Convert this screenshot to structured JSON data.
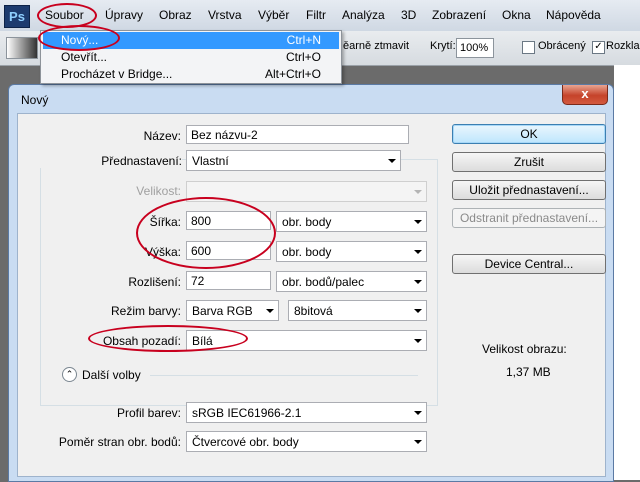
{
  "menubar": {
    "logo": "Ps",
    "items": [
      "Soubor",
      "Úpravy",
      "Obraz",
      "Vrstva",
      "Výběr",
      "Filtr",
      "Analýza",
      "3D",
      "Zobrazení",
      "Okna",
      "Nápověda"
    ]
  },
  "optbar": {
    "smooth_label": "ěarně ztmavit",
    "opacity_label": "Krytí:",
    "opacity_value": "100%",
    "reverse_label": "Obrácený",
    "dither_label": "Rozklad"
  },
  "file_menu": {
    "items": [
      {
        "label": "Nový...",
        "shortcut": "Ctrl+N",
        "selected": true
      },
      {
        "label": "Otevřít...",
        "shortcut": "Ctrl+O",
        "selected": false
      },
      {
        "label": "Procházet v Bridge...",
        "shortcut": "Alt+Ctrl+O",
        "selected": false
      }
    ]
  },
  "dialog": {
    "title": "Nový",
    "close": "x",
    "name_label": "Název:",
    "name_value": "Bez názvu-2",
    "preset_label": "Přednastavení:",
    "preset_value": "Vlastní",
    "size_label": "Velikost:",
    "width_label": "Šířka:",
    "width_value": "800",
    "width_unit": "obr. body",
    "height_label": "Výška:",
    "height_value": "600",
    "height_unit": "obr. body",
    "resolution_label": "Rozlišení:",
    "resolution_value": "72",
    "resolution_unit": "obr. bodů/palec",
    "colormode_label": "Režim barvy:",
    "colormode_value": "Barva RGB",
    "bitdepth_value": "8bitová",
    "background_label": "Obsah pozadí:",
    "background_value": "Bílá",
    "advanced_label": "Další volby",
    "profile_label": "Profil barev:",
    "profile_value": "sRGB IEC61966-2.1",
    "aspect_label": "Poměr stran obr. bodů:",
    "aspect_value": "Čtvercové obr. body",
    "buttons": {
      "ok": "OK",
      "cancel": "Zrušit",
      "save_preset": "Uložit přednastavení...",
      "delete_preset": "Odstranit přednastavení...",
      "device_central": "Device Central..."
    },
    "image_size_label": "Velikost obrazu:",
    "image_size_value": "1,37 MB"
  },
  "colors": {
    "highlight_ring": "#c8001e",
    "menu_selection": "#3399ff",
    "dialog_frame": "#c9dcf2"
  }
}
